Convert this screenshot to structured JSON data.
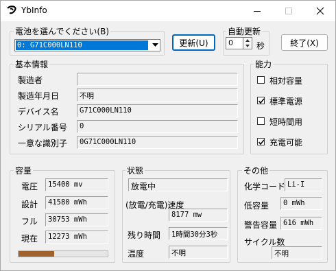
{
  "window": {
    "title": "YbInfo"
  },
  "battery_select": {
    "label": "電池を選んでください(B)",
    "selected": "0: G71C000LN110"
  },
  "buttons": {
    "refresh": "更新(U)",
    "exit": "終了(X)"
  },
  "auto_update": {
    "label": "自動更新",
    "value": "0",
    "unit": "秒"
  },
  "basic_info": {
    "title": "基本情報",
    "rows": [
      {
        "label": "製造者",
        "value": ""
      },
      {
        "label": "製造年月日",
        "value": "不明"
      },
      {
        "label": "デバイス名",
        "value": "G71C000LN110"
      },
      {
        "label": "シリアル番号",
        "value": "0"
      },
      {
        "label": "一意な識別子",
        "value": "0G71C000LN110"
      }
    ]
  },
  "capabilities": {
    "title": "能力",
    "items": [
      {
        "label": "相対容量",
        "checked": false
      },
      {
        "label": "標準電源",
        "checked": true
      },
      {
        "label": "短時間用",
        "checked": false
      },
      {
        "label": "充電可能",
        "checked": true
      }
    ]
  },
  "capacity": {
    "title": "容量",
    "rows": [
      {
        "label": "電圧",
        "value": "15400 mv"
      },
      {
        "label": "設計",
        "value": "41580 mWh"
      },
      {
        "label": "フル",
        "value": "30753 mWh"
      },
      {
        "label": "現在",
        "value": "12273 mWh"
      }
    ],
    "charge_fraction": 0.4
  },
  "status": {
    "title": "状態",
    "state": "放電中",
    "rate_label": "(放電/充電)速度",
    "rate_value": "8177 mw",
    "remaining_label": "残り時間",
    "remaining_value": "1時間30分3秒",
    "temp_label": "温度",
    "temp_value": "不明"
  },
  "other": {
    "title": "その他",
    "chemistry_label": "化学コード",
    "chemistry_value": "Li-I",
    "low_label": "低容量",
    "low_value": "0 mWh",
    "warn_label": "警告容量",
    "warn_value": "616 mWh",
    "cycle_label": "サイクル数",
    "cycle_value": "不明"
  },
  "colors": {
    "accent": "#0067c0",
    "progress": "#a0622d",
    "selection": "#0078d7"
  }
}
